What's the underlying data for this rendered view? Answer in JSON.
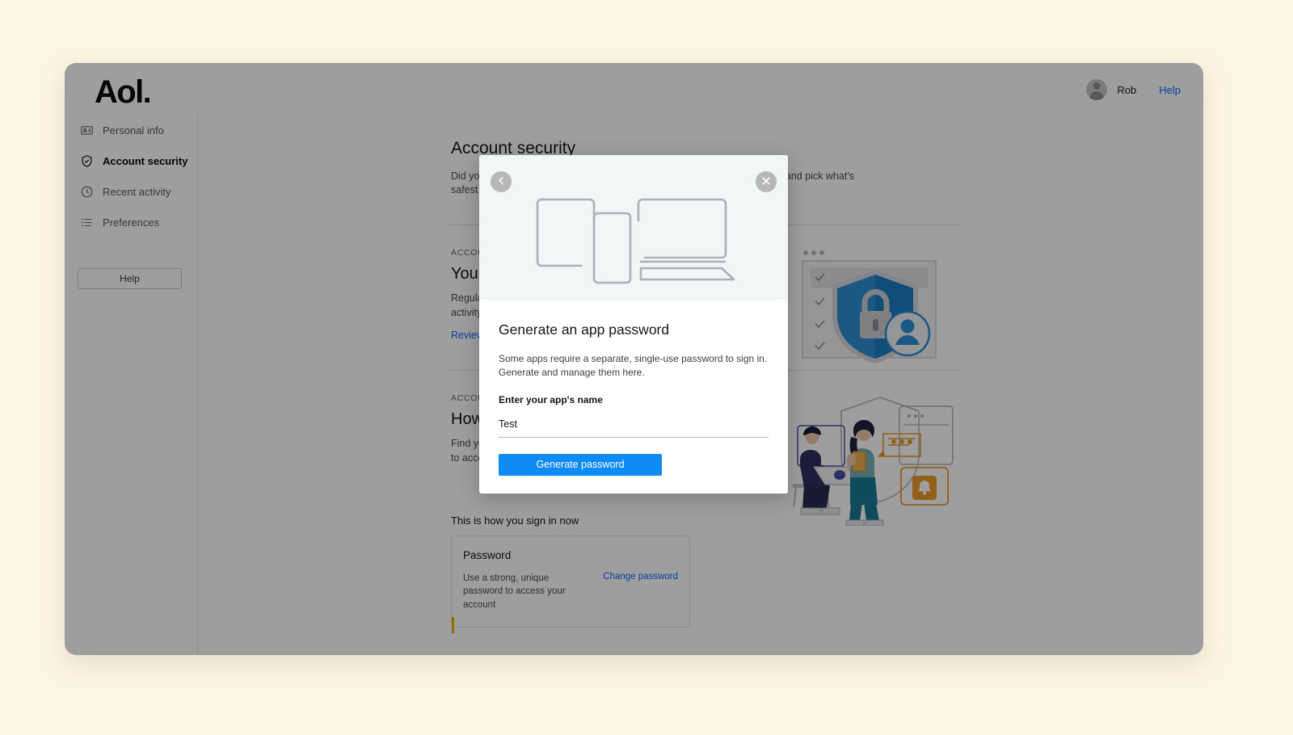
{
  "header": {
    "brand": "Aol.",
    "user_name": "Rob",
    "help_label": "Help"
  },
  "sidebar": {
    "items": [
      {
        "label": "Personal info",
        "icon": "id-card-icon",
        "active": false
      },
      {
        "label": "Account security",
        "icon": "shield-check-icon",
        "active": true
      },
      {
        "label": "Recent activity",
        "icon": "clock-icon",
        "active": false
      },
      {
        "label": "Preferences",
        "icon": "list-icon",
        "active": false
      }
    ],
    "help_button": "Help"
  },
  "main": {
    "page_title": "Account security",
    "page_subtitle": "Did you know there are many ways to sign in to your account? Take a look and pick what's safest for you.",
    "sections": [
      {
        "eyebrow": "ACCOUNT SECURITY",
        "title": "Your account has no issues",
        "body": "Regularly check your account for any suspicious activity.",
        "link": "Review recent activity",
        "art": "security-shield-illustration"
      },
      {
        "eyebrow": "ACCOUNT SECURITY",
        "title": "How you sign in",
        "body": "Find your sign-in options and pick the safest way to access your account.",
        "link": "",
        "art": "people-devices-illustration"
      }
    ],
    "signin_heading": "This is how you sign in now",
    "password_card": {
      "title": "Password",
      "description": "Use a strong, unique password to access your account",
      "action": "Change password"
    }
  },
  "modal": {
    "back_icon": "chevron-left-icon",
    "close_icon": "close-icon",
    "hero_art": "devices-illustration",
    "title": "Generate an app password",
    "description": "Some apps require a separate, single-use password to sign in. Generate and manage them here.",
    "field_label": "Enter your app's name",
    "field_value": "Test",
    "field_placeholder": "",
    "submit_label": "Generate password"
  },
  "colors": {
    "accent_blue": "#0f8bf5",
    "link_blue": "#0f69ff",
    "page_bg": "#fdf5e3",
    "hero_bg": "#f2f6f7",
    "amber": "#f0ad00"
  }
}
